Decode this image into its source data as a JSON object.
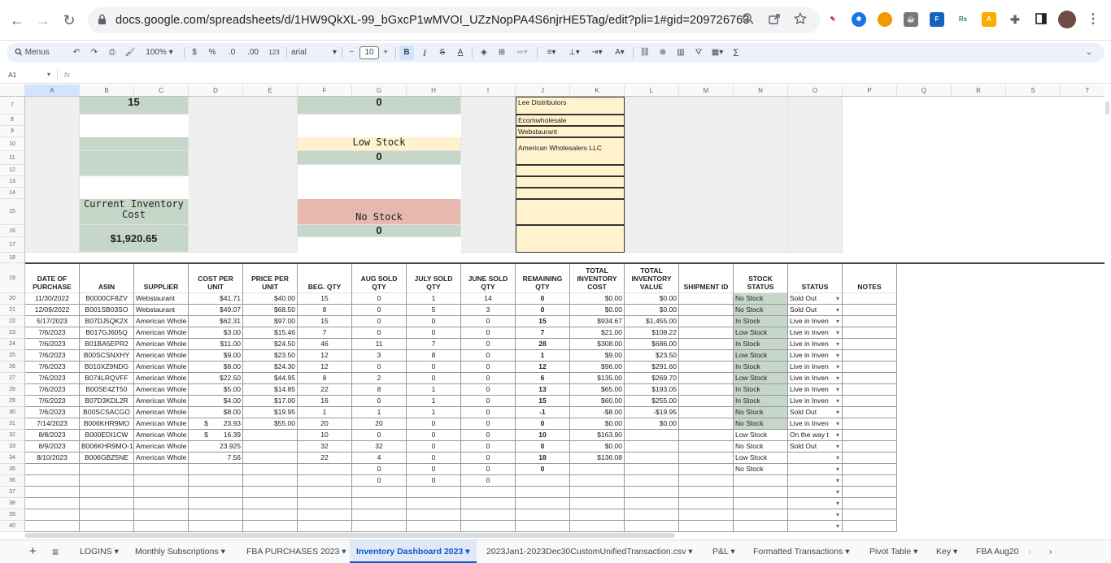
{
  "browser": {
    "url": "docs.google.com/spreadsheets/d/1HW9QkXL-99_bGxcP1wMVOI_UZzNopPA4S6njrHE5Tag/edit?pli=1#gid=209726763",
    "back_icon": "←",
    "forward_icon": "→",
    "reload_icon": "↻"
  },
  "toolbar": {
    "menus": "Menus",
    "zoom": "100%",
    "currency": "$",
    "percent": "%",
    "dec_less": ".0",
    "dec_more": ".00",
    "format_num": "123",
    "font": "arial",
    "font_size": "10",
    "minus": "−",
    "plus": "+",
    "bold": "B",
    "italic": "I",
    "strike": "S",
    "text_color": "A",
    "sigma": "Σ"
  },
  "formula_bar": {
    "cell_ref": "A1",
    "fx": "fx"
  },
  "columns": [
    "A",
    "B",
    "C",
    "D",
    "E",
    "F",
    "G",
    "H",
    "I",
    "J",
    "K",
    "L",
    "M",
    "N",
    "O",
    "P",
    "Q",
    "R",
    "S",
    "T"
  ],
  "summary": {
    "b7": "15",
    "g7": "0",
    "low_stock_label": "Low Stock",
    "g11": "0",
    "current_inventory_cost_label": "Current Inventory Cost",
    "current_inventory_cost": "$1,920.65",
    "no_stock_label": "No Stock",
    "g16": "0",
    "suppliers": [
      "Lee Distributors",
      "Ecomwholesale",
      "Webstaurant",
      "American Wholesalers LLC"
    ]
  },
  "table_headers": [
    "DATE OF PURCHASE",
    "ASIN",
    "SUPPLIER",
    "COST PER UNIT",
    "PRICE PER UNIT",
    "BEG. QTY",
    "AUG SOLD QTY",
    "JULY SOLD QTY",
    "JUNE SOLD QTY",
    "REMAINING QTY",
    "TOTAL INVENTORY COST",
    "TOTAL INVENTORY VALUE",
    "SHIPMENT ID",
    "STOCK STATUS",
    "STATUS",
    "NOTES"
  ],
  "rows": [
    [
      "11/30/2022",
      "B0000CF8ZV",
      "Webstaurant",
      "$41.71",
      "$40.00",
      "15",
      "0",
      "1",
      "14",
      "0",
      "$0.00",
      "$0.00",
      "",
      "No Stock",
      "Sold Out",
      ""
    ],
    [
      "12/09/2022",
      "B001SB03SO",
      "Webstaurant",
      "$49.07",
      "$68.50",
      "8",
      "0",
      "5",
      "3",
      "0",
      "$0.00",
      "$0.00",
      "",
      "No Stock",
      "Sold Out",
      ""
    ],
    [
      "5/17/2023",
      "B07DJ5QK2X",
      "American Whole",
      "$62.31",
      "$97.00",
      "15",
      "0",
      "0",
      "0",
      "15",
      "$934.67",
      "$1,455.00",
      "",
      "In Stock",
      "Live in Inven",
      ""
    ],
    [
      "7/6/2023",
      "B017GJ605Q",
      "American Whole",
      "$3.00",
      "$15.46",
      "7",
      "0",
      "0",
      "0",
      "7",
      "$21.00",
      "$108.22",
      "",
      "Low Stock",
      "Live in Inven",
      ""
    ],
    [
      "7/6/2023",
      "B01BA5EPR2",
      "American Whole",
      "$11.00",
      "$24.50",
      "46",
      "11",
      "7",
      "0",
      "28",
      "$308.00",
      "$686.00",
      "",
      "In Stock",
      "Live in Inven",
      ""
    ],
    [
      "7/6/2023",
      "B00SCSNXHY",
      "American Whole",
      "$9.00",
      "$23.50",
      "12",
      "3",
      "8",
      "0",
      "1",
      "$9.00",
      "$23.50",
      "",
      "Low Stock",
      "Live in Inven",
      ""
    ],
    [
      "7/6/2023",
      "B010XZ9NDG",
      "American Whole",
      "$8.00",
      "$24.30",
      "12",
      "0",
      "0",
      "0",
      "12",
      "$96.00",
      "$291.60",
      "",
      "In Stock",
      "Live in Inven",
      ""
    ],
    [
      "7/6/2023",
      "B074LRQVFF",
      "American Whole",
      "$22.50",
      "$44.95",
      "8",
      "2",
      "0",
      "0",
      "6",
      "$135.00",
      "$269.70",
      "",
      "Low Stock",
      "Live in Inven",
      ""
    ],
    [
      "7/6/2023",
      "B00SE4ZT50",
      "American Whole",
      "$5.00",
      "$14.85",
      "22",
      "8",
      "1",
      "0",
      "13",
      "$65.00",
      "$193.05",
      "",
      "In Stock",
      "Live in Inven",
      ""
    ],
    [
      "7/6/2023",
      "B07D3KDL2R",
      "American Whole",
      "$4.00",
      "$17.00",
      "16",
      "0",
      "1",
      "0",
      "15",
      "$60.00",
      "$255.00",
      "",
      "In Stock",
      "Live in Inven",
      ""
    ],
    [
      "7/6/2023",
      "B00SCSACGO",
      "American Whole",
      "$8.00",
      "$19.95",
      "1",
      "1",
      "1",
      "0",
      "-1",
      "-$8.00",
      "-$19.95",
      "",
      "No Stock",
      "Sold Out",
      ""
    ],
    [
      "7/14/2023",
      "B006KHR9MO",
      "American Whole",
      "$        23.93",
      "$55.00",
      "20",
      "20",
      "0",
      "0",
      "0",
      "$0.00",
      "$0.00",
      "",
      "No Stock",
      "Live in Inven",
      ""
    ],
    [
      "8/8/2023",
      "B000EDI1CW",
      "American Whole",
      "$        16.39",
      "",
      "10",
      "0",
      "0",
      "0",
      "10",
      "$163.90",
      "",
      "",
      "Low Stock",
      "On the way t",
      ""
    ],
    [
      "8/9/2023",
      "B006KHR9MO-1",
      "American Whole",
      "23.925",
      "",
      "32",
      "32",
      "0",
      "0",
      "0",
      "$0.00",
      "",
      "",
      "No Stock",
      "Sold Out",
      ""
    ],
    [
      "8/10/2023",
      "B006GBZ5NE",
      "American Whole",
      "7.56",
      "",
      "22",
      "4",
      "0",
      "0",
      "18",
      "$136.08",
      "",
      "",
      "Low Stock",
      "",
      ""
    ],
    [
      "",
      "",
      "",
      "",
      "",
      "",
      "0",
      "0",
      "0",
      "0",
      "",
      "",
      "",
      "No Stock",
      "",
      ""
    ],
    [
      "",
      "",
      "",
      "",
      "",
      "",
      "0",
      "0",
      "0",
      "",
      "",
      "",
      "",
      "",
      "",
      ""
    ]
  ],
  "sheet_tabs": [
    "LOGINS",
    "Monthly Subscriptions",
    "FBA PURCHASES 2023",
    "Inventory Dashboard 2023",
    "2023Jan1-2023Dec30CustomUnifiedTransaction.csv",
    "P&L",
    "Formatted Transactions",
    "Pivot Table",
    "Key",
    "FBA Aug20"
  ],
  "colors": {
    "green": "#c6d7c9",
    "yellow": "#fff2cc",
    "pink": "#e6b8af",
    "active_tab": "#0b57d0"
  }
}
